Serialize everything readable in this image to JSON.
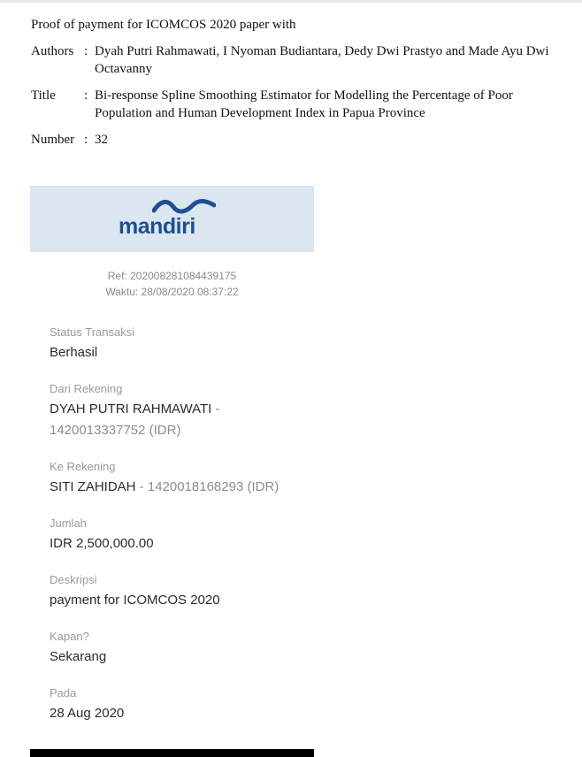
{
  "document": {
    "heading": "Proof of payment for ICOMCOS 2020 paper with",
    "authors_label": "Authors",
    "authors_value": "Dyah Putri Rahmawati, I Nyoman Budiantara, Dedy Dwi Prastyo and Made Ayu Dwi Octavanny",
    "title_label": "Title",
    "title_value": "Bi-response Spline Smoothing Estimator for Modelling the Percentage of Poor Population and Human Development Index in Papua Province",
    "number_label": "Number",
    "number_value": "32",
    "colon": ":"
  },
  "receipt": {
    "bank_logo": "mandiri",
    "ref": "Ref: 202008281084439175",
    "time": "Waktu: 28/08/2020 08:37:22",
    "status_label": "Status Transaksi",
    "status_value": "Berhasil",
    "from_label": "Dari Rekening",
    "from_name": "DYAH PUTRI RAHMAWATI",
    "from_account": " - 1420013337752 (IDR)",
    "to_label": "Ke Rekening",
    "to_name": "SITI ZAHIDAH",
    "to_account": " - 1420018168293 (IDR)",
    "amount_label": "Jumlah",
    "amount_value": "IDR 2,500,000.00",
    "desc_label": "Deskripsi",
    "desc_value": "payment for ICOMCOS 2020",
    "when_label": "Kapan?",
    "when_value": "Sekarang",
    "date_label": "Pada",
    "date_value": "28 Aug 2020"
  },
  "colors": {
    "banner_bg": "#dce6f1",
    "logo_blue": "#1f4f8f"
  }
}
